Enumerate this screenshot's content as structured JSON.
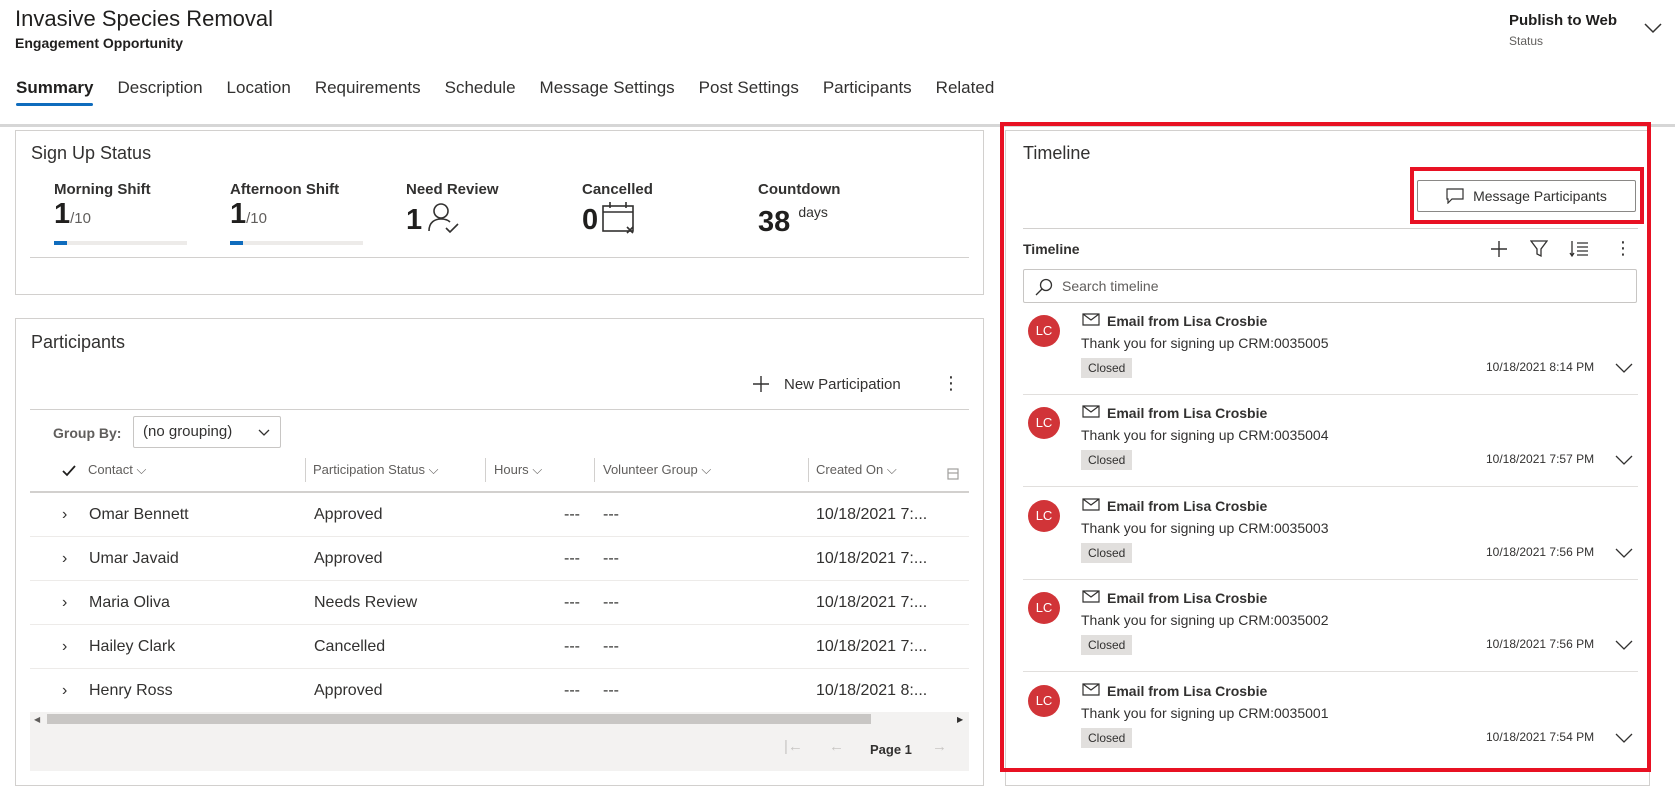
{
  "header": {
    "title": "Invasive Species Removal",
    "subtitle": "Engagement Opportunity",
    "status_value": "Publish to Web",
    "status_label": "Status"
  },
  "tabs": [
    "Summary",
    "Description",
    "Location",
    "Requirements",
    "Schedule",
    "Message Settings",
    "Post Settings",
    "Participants",
    "Related"
  ],
  "signup": {
    "title": "Sign Up Status",
    "morning_label": "Morning Shift",
    "morning_value": "1",
    "morning_total": "/10",
    "morning_progress": 0.1,
    "afternoon_label": "Afternoon Shift",
    "afternoon_value": "1",
    "afternoon_total": "/10",
    "afternoon_progress": 0.1,
    "review_label": "Need Review",
    "review_value": "1",
    "cancelled_label": "Cancelled",
    "cancelled_value": "0",
    "countdown_label": "Countdown",
    "countdown_value": "38",
    "countdown_unit": "days"
  },
  "participants": {
    "title": "Participants",
    "new_label": "New Participation",
    "group_by_label": "Group By:",
    "group_by_value": "(no grouping)",
    "columns": [
      "Contact",
      "Participation Status",
      "Hours",
      "Volunteer Group",
      "Created On"
    ],
    "rows": [
      {
        "contact": "Omar Bennett",
        "status": "Approved",
        "hours": "---",
        "group": "---",
        "created": "10/18/2021 7:..."
      },
      {
        "contact": "Umar Javaid",
        "status": "Approved",
        "hours": "---",
        "group": "---",
        "created": "10/18/2021 7:..."
      },
      {
        "contact": "Maria Oliva",
        "status": "Needs Review",
        "hours": "---",
        "group": "---",
        "created": "10/18/2021 7:..."
      },
      {
        "contact": "Hailey Clark",
        "status": "Cancelled",
        "hours": "---",
        "group": "---",
        "created": "10/18/2021 7:..."
      },
      {
        "contact": "Henry Ross",
        "status": "Approved",
        "hours": "---",
        "group": "---",
        "created": "10/18/2021 8:..."
      }
    ],
    "page_label": "Page 1"
  },
  "timeline": {
    "title": "Timeline",
    "message_button": "Message Participants",
    "sub_title": "Timeline",
    "search_placeholder": "Search timeline",
    "items": [
      {
        "initials": "LC",
        "title": "Email from Lisa Crosbie",
        "body": "Thank you for signing up CRM:0035005",
        "badge": "Closed",
        "time": "10/18/2021 8:14 PM"
      },
      {
        "initials": "LC",
        "title": "Email from Lisa Crosbie",
        "body": "Thank you for signing up CRM:0035004",
        "badge": "Closed",
        "time": "10/18/2021 7:57 PM"
      },
      {
        "initials": "LC",
        "title": "Email from Lisa Crosbie",
        "body": "Thank you for signing up CRM:0035003",
        "badge": "Closed",
        "time": "10/18/2021 7:56 PM"
      },
      {
        "initials": "LC",
        "title": "Email from Lisa Crosbie",
        "body": "Thank you for signing up CRM:0035002",
        "badge": "Closed",
        "time": "10/18/2021 7:56 PM"
      },
      {
        "initials": "LC",
        "title": "Email from Lisa Crosbie",
        "body": "Thank you for signing up CRM:0035001",
        "badge": "Closed",
        "time": "10/18/2021 7:54 PM"
      }
    ]
  },
  "colors": {
    "accent": "#0f6cbd",
    "highlight": "#e81123",
    "avatar": "#d13438"
  }
}
